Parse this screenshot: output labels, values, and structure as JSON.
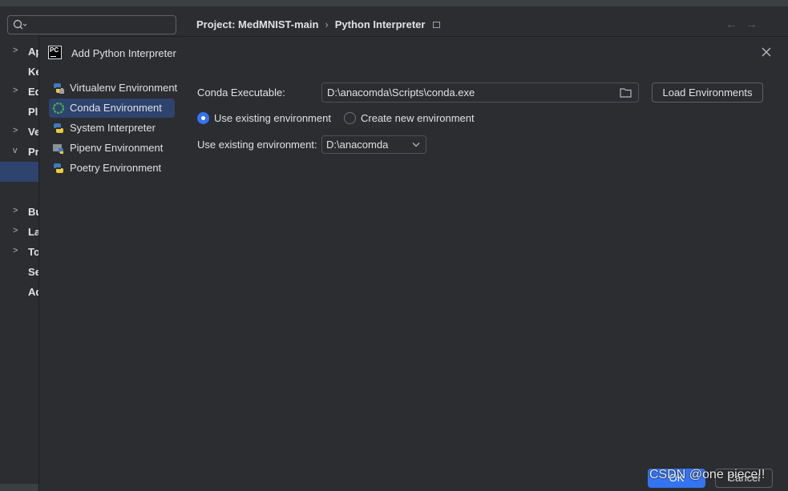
{
  "settings": {
    "search_placeholder": "",
    "breadcrumb": {
      "project": "Project: MedMNIST-main",
      "page": "Python Interpreter"
    },
    "nav_back": "←",
    "nav_forward": "→",
    "tree": [
      {
        "label": "Ap",
        "expandable": true
      },
      {
        "label": "Ke",
        "expandable": false
      },
      {
        "label": "Ed",
        "expandable": true
      },
      {
        "label": "Pl",
        "expandable": false
      },
      {
        "label": "Ve",
        "expandable": true
      },
      {
        "label": "Pr",
        "expandable": true,
        "expanded": true
      },
      {
        "label": "Bu",
        "expandable": true
      },
      {
        "label": "La",
        "expandable": true
      },
      {
        "label": "To",
        "expandable": true
      },
      {
        "label": "Se",
        "expandable": false
      },
      {
        "label": "Ad",
        "expandable": false
      }
    ]
  },
  "dialog": {
    "logo_text": "PC",
    "title": "Add Python Interpreter",
    "env_types": [
      {
        "label": "Virtualenv Environment",
        "icon": "python-virtualenv-icon",
        "selected": false
      },
      {
        "label": "Conda Environment",
        "icon": "conda-icon",
        "selected": true
      },
      {
        "label": "System Interpreter",
        "icon": "python-icon",
        "selected": false
      },
      {
        "label": "Pipenv Environment",
        "icon": "pipenv-icon",
        "selected": false
      },
      {
        "label": "Poetry Environment",
        "icon": "python-poetry-icon",
        "selected": false
      }
    ],
    "conda_executable_label": "Conda Executable:",
    "conda_executable_value": "D:\\anacomda\\Scripts\\conda.exe",
    "load_environments_label": "Load Environments",
    "radio_use_existing": "Use existing environment",
    "radio_create_new": "Create new environment",
    "use_existing_label": "Use existing environment:",
    "use_existing_value": "D:\\anacomda",
    "ok_label": "OK",
    "cancel_label": "Cancel"
  },
  "watermark": "CSDN @one piece!!",
  "colors": {
    "background": "#2b2d30",
    "accent": "#3574f0",
    "selection": "#2e436e",
    "text": "#dfe1e5"
  }
}
